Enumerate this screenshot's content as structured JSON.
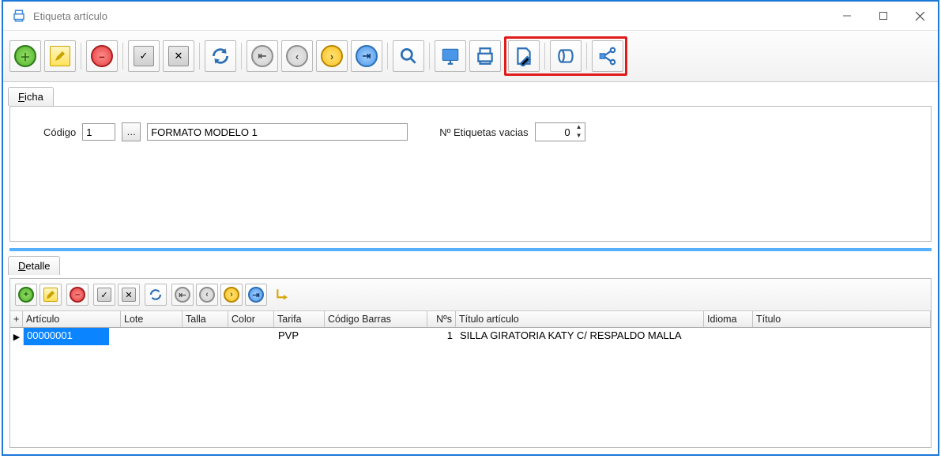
{
  "window": {
    "title": "Etiqueta artículo"
  },
  "toolbar_main": {
    "icons": {
      "add": "Añadir",
      "edit": "Editar",
      "delete": "Eliminar",
      "confirm": "Confirmar",
      "cancel": "Cancelar",
      "refresh": "Refrescar",
      "first": "Primero",
      "prev": "Anterior",
      "next": "Siguiente",
      "last": "Último",
      "search": "Buscar",
      "screen": "Pantalla",
      "print": "Imprimir",
      "design": "Diseño",
      "roll": "Rollo",
      "share": "Exportar"
    }
  },
  "tabs": {
    "ficha_letter": "F",
    "ficha_rest": "icha",
    "detalle_letter": "D",
    "detalle_rest": "etalle"
  },
  "ficha": {
    "codigo_label": "Código",
    "codigo_value": "1",
    "codigo_desc": "FORMATO MODELO 1",
    "etiquetas_label": "Nº Etiquetas vacias",
    "etiquetas_value": "0"
  },
  "grid": {
    "headers": {
      "plus": "+",
      "articulo": "Artículo",
      "lote": "Lote",
      "talla": "Talla",
      "color": "Color",
      "tarifa": "Tarifa",
      "codigo_barras": "Código Barras",
      "nos": "Nºs",
      "titulo_articulo": "Título artículo",
      "idioma": "Idioma",
      "titulo": "Título"
    },
    "row": {
      "marker": "▶",
      "articulo": "00000001",
      "lote": "",
      "talla": "",
      "color": "",
      "tarifa": "PVP",
      "codigo_barras": "",
      "nos": "1",
      "titulo_articulo": "SILLA GIRATORIA KATY C/ RESPALDO MALLA",
      "idioma": "",
      "titulo": ""
    }
  },
  "detalle_toolbar": {
    "icons": {
      "add": "Añadir",
      "edit": "Editar",
      "delete": "Eliminar",
      "confirm": "Confirmar",
      "cancel": "Cancelar",
      "refresh": "Refrescar",
      "first": "Primero",
      "prev": "Anterior",
      "next": "Siguiente",
      "last": "Último",
      "go": "Ir"
    }
  },
  "colors": {
    "accent_blue": "#1e78d7",
    "highlight_red": "#e11a1a",
    "row_select": "#0a84ff"
  }
}
